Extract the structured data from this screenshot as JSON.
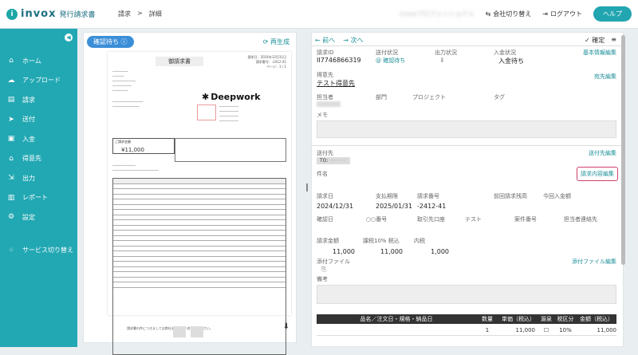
{
  "topbar": {
    "logo": "invox",
    "logo_sub": "発行請求書",
    "crumb1": "請求",
    "crumb_sep": ">",
    "crumb2": "詳細",
    "user": "invoxプロフェッショナル",
    "switch_company": "会社切り替え",
    "logout": "ログアウト",
    "help": "ヘルプ"
  },
  "sidebar": {
    "items": [
      {
        "label": "ホーム",
        "icon": "home-icon"
      },
      {
        "label": "アップロード",
        "icon": "upload-icon"
      },
      {
        "label": "請求",
        "icon": "invoice-icon"
      },
      {
        "label": "送付",
        "icon": "send-icon"
      },
      {
        "label": "入金",
        "icon": "deposit-icon"
      },
      {
        "label": "得意先",
        "icon": "customer-icon"
      },
      {
        "label": "出力",
        "icon": "output-icon"
      },
      {
        "label": "レポート",
        "icon": "report-icon"
      },
      {
        "label": "設定",
        "icon": "gear-icon"
      }
    ],
    "service_switch": "サービス切り替え"
  },
  "docpanel": {
    "status_badge": "確認待ち",
    "regenerate": "再生成",
    "doc_title": "御請求書",
    "doc_meta": "請求日：2024年12月31日\n請求番号：-2412-41\nページ：1 / 1",
    "brand": "Deepwork",
    "total_label": "ご請求金額",
    "total_value": "¥11,000",
    "footer_note": "請求書の件につきましては弊社までお問い合わせください。"
  },
  "detail": {
    "prev": "前へ",
    "next": "次へ",
    "confirm": "確定",
    "request_id_label": "請求ID",
    "request_id": "II7746866319",
    "send_status_label": "送付状況",
    "send_status": "確認待ち",
    "output_status_label": "出力状況",
    "deposit_status_label": "入金状況",
    "deposit_status": "入金待ち",
    "basic_edit": "基本情報編集",
    "customer_label": "得意先",
    "customer": "テスト得意先",
    "dest_edit": "宛先編集",
    "person_label": "担当者",
    "dept_label": "部門",
    "project_label": "プロジェクト",
    "tag_label": "タグ",
    "memo_label": "メモ",
    "send_to_label": "送付先",
    "send_to_tag": "TO:",
    "send_to_edit": "送付先編集",
    "subject_label": "件名",
    "content_edit": "請求内容編集",
    "grid1": [
      {
        "label": "請求日",
        "value": "2024/12/31"
      },
      {
        "label": "支払期限",
        "value": "2025/01/31"
      },
      {
        "label": "請求番号",
        "value": "-2412-41"
      },
      {
        "label": "前回請求残高",
        "value": ""
      },
      {
        "label": "今回入金額",
        "value": ""
      }
    ],
    "grid2": [
      {
        "label": "確認日",
        "value": "○○番号"
      },
      {
        "label": "取引先口座",
        "value": "テスト"
      },
      {
        "label": "案件番号",
        "value": ""
      },
      {
        "label": "担当者連絡先",
        "value": ""
      }
    ],
    "amount_label": "請求金額",
    "amount": "11,000",
    "taxable_label": "課税10% 税込",
    "taxable": "11,000",
    "tax_label": "内税",
    "tax": "1,000",
    "attach_label": "添付ファイル",
    "attach_edit": "添付ファイル編集",
    "remarks_label": "備考",
    "items_head": [
      "品名／注文日・規格・納品日",
      "数量",
      "単価（税込）",
      "源泉",
      "税区分",
      "金額（税込）"
    ],
    "items_row": [
      "",
      "1",
      "11,000",
      "",
      "10%",
      "11,000"
    ]
  },
  "colors": {
    "accent": "#22a8b3",
    "badge": "#3b8ed8",
    "highlight": "#d0406a"
  }
}
